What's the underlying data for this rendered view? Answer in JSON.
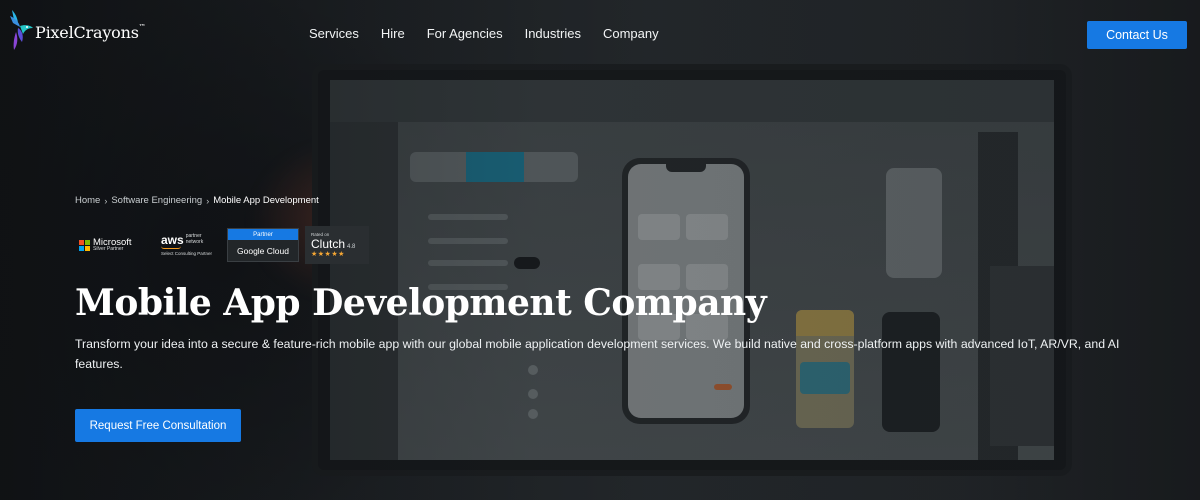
{
  "brand": {
    "name": "PixelCrayons",
    "tm": "™"
  },
  "nav": {
    "items": [
      {
        "label": "Services"
      },
      {
        "label": "Hire"
      },
      {
        "label": "For Agencies"
      },
      {
        "label": "Industries"
      },
      {
        "label": "Company"
      }
    ],
    "contact_label": "Contact Us"
  },
  "hero": {
    "breadcrumb": {
      "items": [
        {
          "label": "Home"
        },
        {
          "label": "Software Engineering"
        }
      ],
      "current": "Mobile App Development"
    },
    "badges": {
      "microsoft": {
        "title": "Microsoft",
        "sub": "Silver Partner"
      },
      "aws": {
        "word": "aws",
        "partner_line1": "partner",
        "partner_line2": "network",
        "tier": "Select Consulting Partner"
      },
      "google": {
        "tag": "Partner",
        "name": "Google Cloud"
      },
      "clutch": {
        "rated": "Rated on",
        "name": "Clutch",
        "score": "4.8",
        "stars": "★★★★★"
      }
    },
    "title": "Mobile App Development Company",
    "description": "Transform your idea into a secure & feature-rich mobile app with our global mobile application development services. We build native and cross-platform apps with advanced IoT, AR/VR, and AI features.",
    "cta_label": "Request Free Consultation"
  },
  "colors": {
    "accent": "#1679e3",
    "background": "#1b1e22",
    "star": "#f4a634"
  }
}
